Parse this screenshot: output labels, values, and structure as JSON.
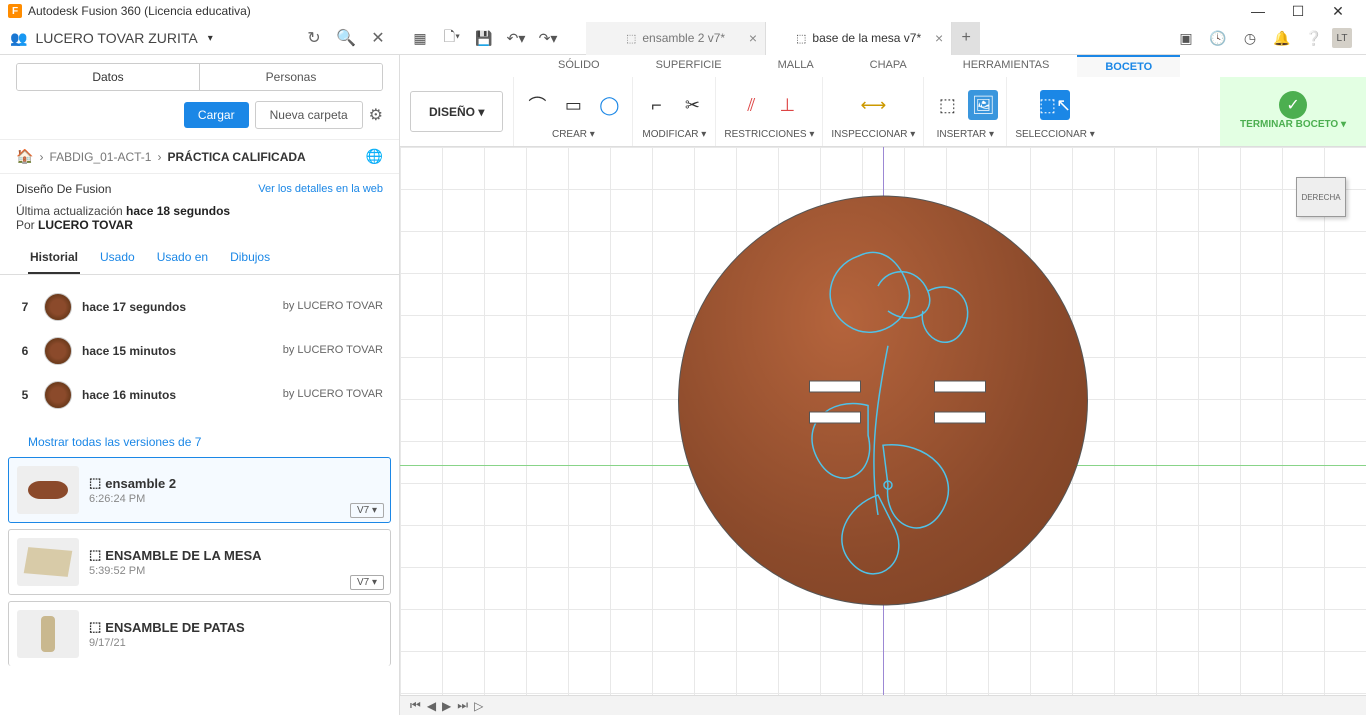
{
  "window": {
    "title": "Autodesk Fusion 360 (Licencia educativa)"
  },
  "appbar": {
    "username": "LUCERO TOVAR ZURITA",
    "tabs": [
      {
        "label": "ensamble 2 v7*",
        "active": false
      },
      {
        "label": "base de la mesa v7*",
        "active": true
      }
    ],
    "avatar": "LT"
  },
  "sidebar": {
    "tab_datos": "Datos",
    "tab_personas": "Personas",
    "btn_cargar": "Cargar",
    "btn_nueva": "Nueva carpeta",
    "breadcrumb": {
      "proj": "FABDIG_01-ACT-1",
      "item": "PRÁCTICA CALIFICADA"
    },
    "proj_title": "Diseño De Fusion",
    "proj_link": "Ver los detalles en la web",
    "last_update_prefix": "Última actualización ",
    "last_update_time": "hace 18 segundos",
    "by_prefix": "Por ",
    "by_user": "LUCERO TOVAR",
    "hist_tabs": {
      "historial": "Historial",
      "usado": "Usado",
      "usado_en": "Usado en",
      "dibujos": "Dibujos"
    },
    "history": [
      {
        "num": "7",
        "time": "hace 17 segundos",
        "by": "by LUCERO TOVAR"
      },
      {
        "num": "6",
        "time": "hace 15 minutos",
        "by": "by LUCERO TOVAR"
      },
      {
        "num": "5",
        "time": "hace 16 minutos",
        "by": "by LUCERO TOVAR"
      }
    ],
    "show_all": "Mostrar todas las versiones de 7",
    "files": [
      {
        "name": "ensamble 2",
        "time": "6:26:24 PM",
        "ver": "V7 ▾",
        "selected": true
      },
      {
        "name": "ENSAMBLE DE LA MESA",
        "time": "5:39:52 PM",
        "ver": "V7 ▾",
        "selected": false
      },
      {
        "name": "ENSAMBLE DE PATAS",
        "time": "9/17/21",
        "ver": "",
        "selected": false
      }
    ]
  },
  "ribbon": {
    "design": "DISEÑO ▾",
    "tabs": {
      "solido": "SÓLIDO",
      "superficie": "SUPERFICIE",
      "malla": "MALLA",
      "chapa": "CHAPA",
      "herramientas": "HERRAMIENTAS",
      "boceto": "BOCETO"
    },
    "groups": {
      "crear": "CREAR ▾",
      "modificar": "MODIFICAR ▾",
      "restricciones": "RESTRICCIONES ▾",
      "inspeccionar": "INSPECCIONAR ▾",
      "insertar": "INSERTAR ▾",
      "seleccionar": "SELECCIONAR ▾",
      "terminar": "TERMINAR BOCETO ▾"
    }
  },
  "viewcube": "DERECHA"
}
